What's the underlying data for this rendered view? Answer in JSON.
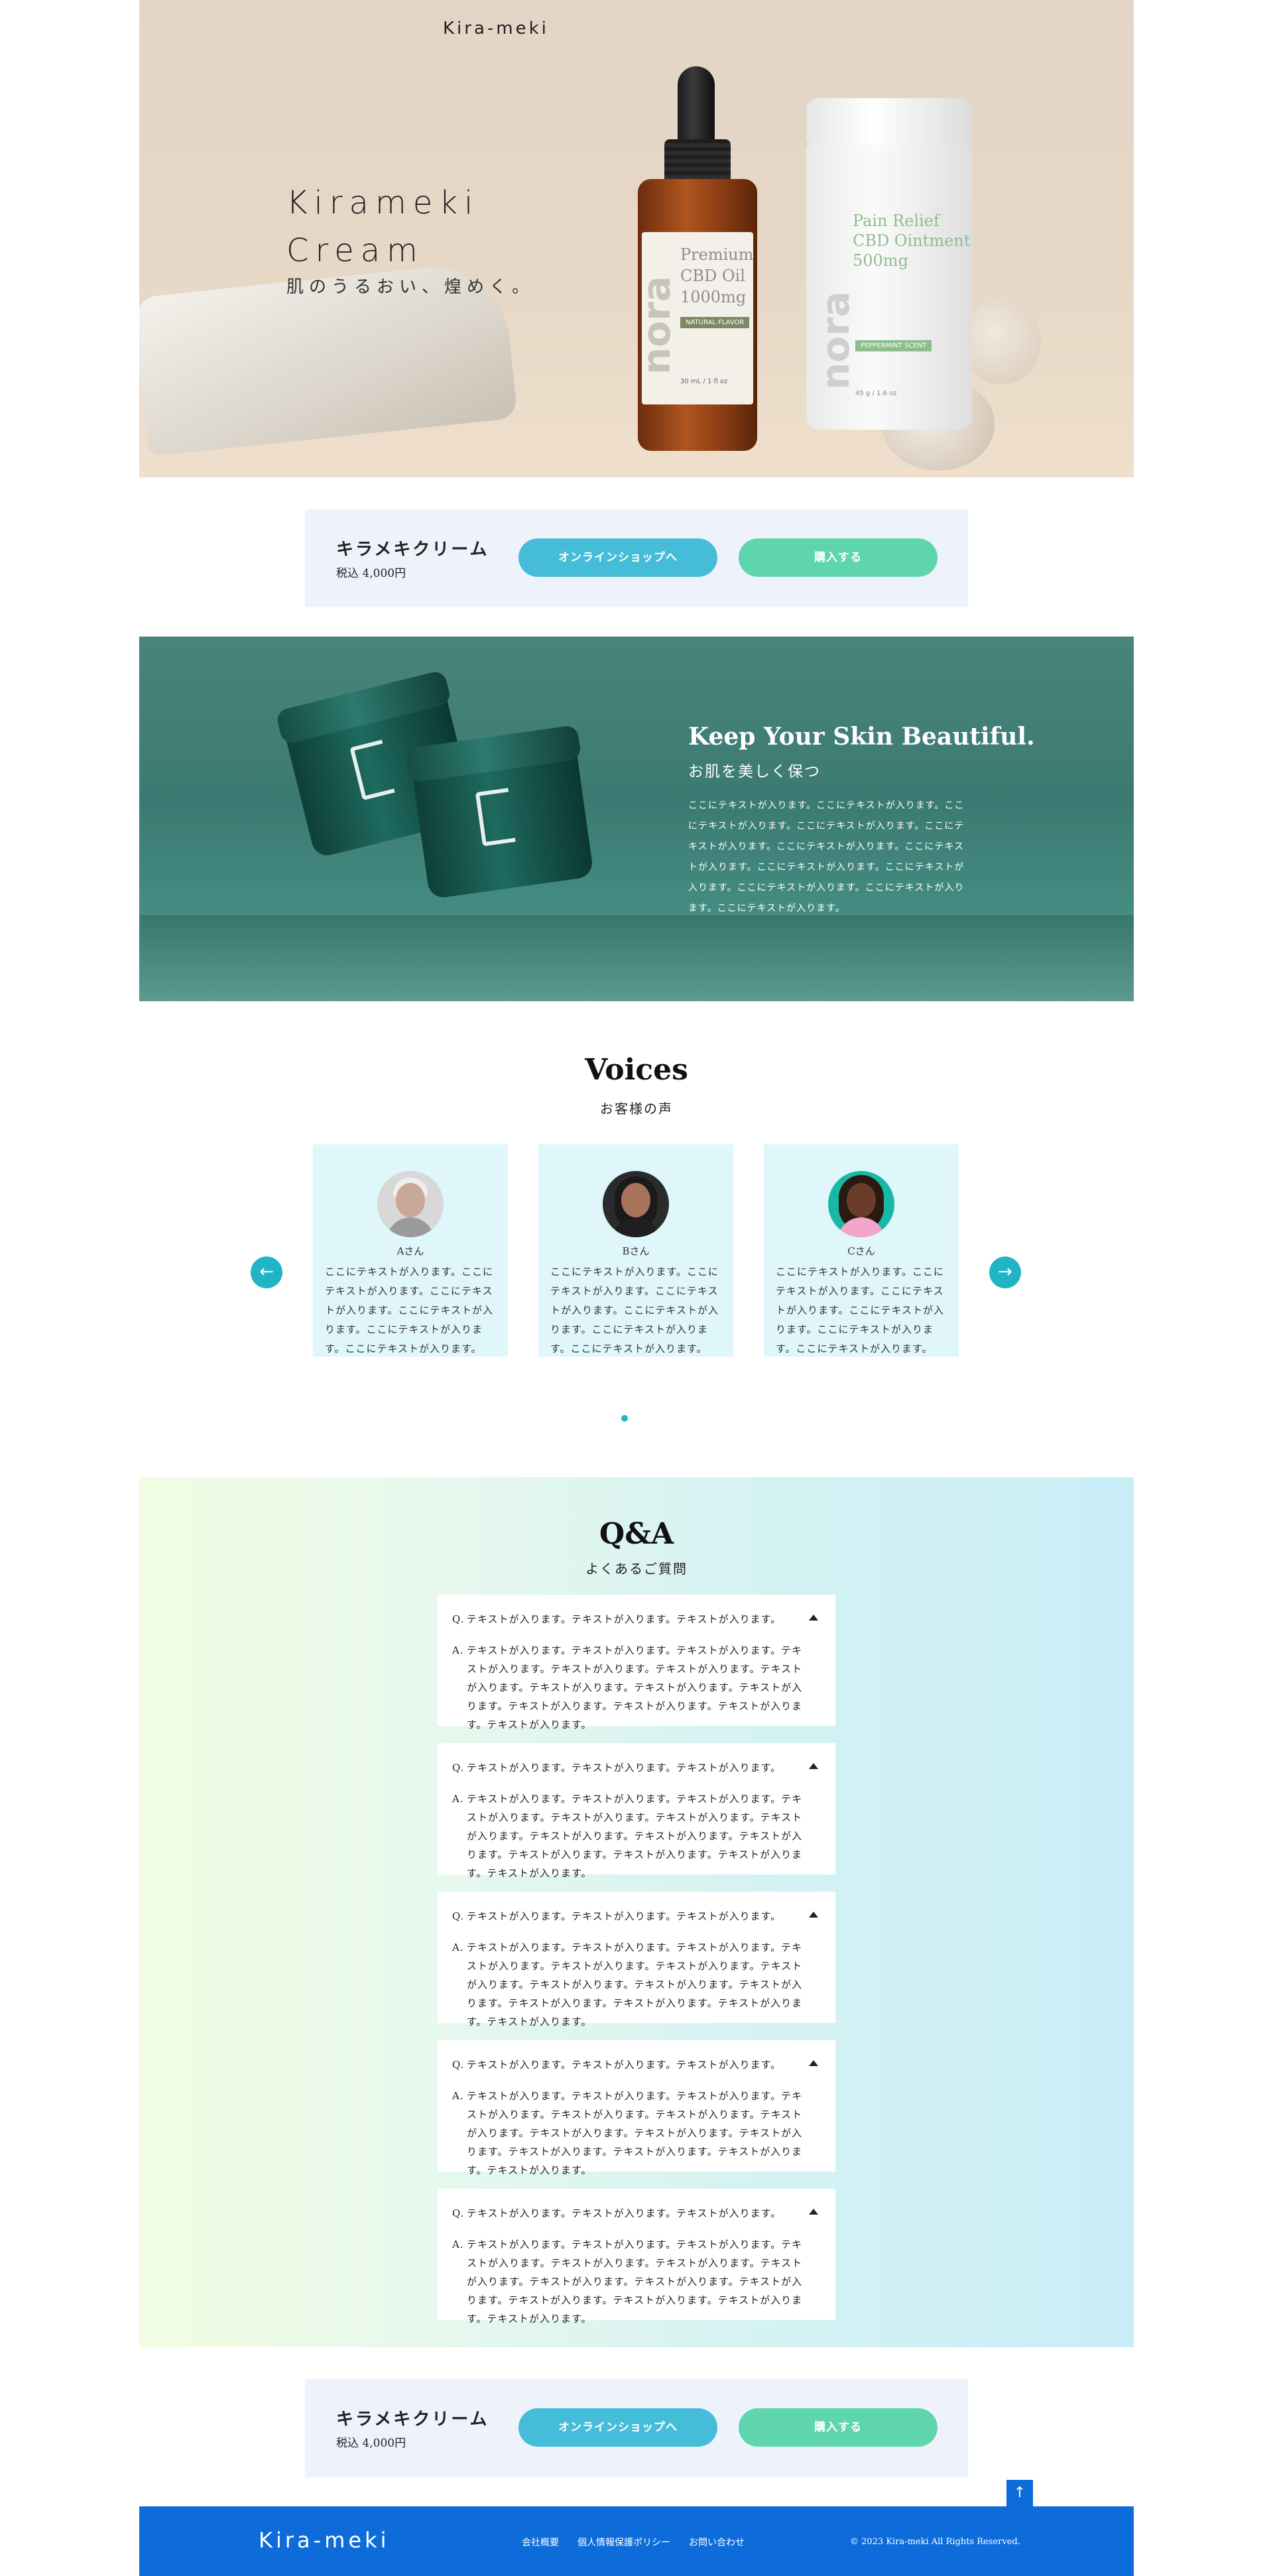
{
  "header": {
    "brand": "Kira-meki"
  },
  "hero": {
    "title_line1": "Kirameki",
    "title_line2": "Cream",
    "subtitle": "肌のうるおい、煌めく。",
    "bottle": {
      "brand": "nora",
      "line1": "Premium",
      "line2": "CBD Oil",
      "line3": "1000mg",
      "badge": "NATURAL FLAVOR",
      "size": "30 mL / 1 fl oz"
    },
    "jar": {
      "brand": "nora",
      "line1": "Pain Relief",
      "line2": "CBD Ointment",
      "line3": "500mg",
      "badge": "PEPPERMINT SCENT",
      "size": "45 g / 1.6 oz"
    }
  },
  "buybar": {
    "product_name": "キラメキクリーム",
    "price": "税込 4,000円",
    "shop_label": "オンラインショップへ",
    "buy_label": "購入する"
  },
  "feature": {
    "title": "Keep Your Skin Beautiful.",
    "subtitle": "お肌を美しく保つ",
    "body": "ここにテキストが入ります。ここにテキストが入ります。ここにテキストが入ります。ここにテキストが入ります。ここにテキストが入ります。ここにテキストが入ります。ここにテキストが入ります。ここにテキストが入ります。ここにテキストが入ります。ここにテキストが入ります。ここにテキストが入ります。ここにテキストが入ります。"
  },
  "voices": {
    "title": "Voices",
    "subtitle": "お客様の声",
    "items": [
      {
        "name": "Aさん",
        "text": "ここにテキストが入ります。ここにテキストが入ります。ここにテキストが入ります。ここにテキストが入ります。ここにテキストが入ります。ここにテキストが入ります。"
      },
      {
        "name": "Bさん",
        "text": "ここにテキストが入ります。ここにテキストが入ります。ここにテキストが入ります。ここにテキストが入ります。ここにテキストが入ります。ここにテキストが入ります。"
      },
      {
        "name": "Cさん",
        "text": "ここにテキストが入ります。ここにテキストが入ります。ここにテキストが入ります。ここにテキストが入ります。ここにテキストが入ります。ここにテキストが入ります。"
      }
    ],
    "prev_icon": "arrow-left-icon",
    "next_icon": "arrow-right-icon"
  },
  "qa": {
    "title": "Q&A",
    "subtitle": "よくあるご質問",
    "q_mark": "Q.",
    "a_mark": "A.",
    "items": [
      {
        "q": "テキストが入ります。テキストが入ります。テキストが入ります。",
        "a": "テキストが入ります。テキストが入ります。テキストが入ります。テキストが入ります。テキストが入ります。テキストが入ります。テキストが入ります。テキストが入ります。テキストが入ります。テキストが入ります。テキストが入ります。テキストが入ります。テキストが入ります。テキストが入ります。"
      },
      {
        "q": "テキストが入ります。テキストが入ります。テキストが入ります。",
        "a": "テキストが入ります。テキストが入ります。テキストが入ります。テキストが入ります。テキストが入ります。テキストが入ります。テキストが入ります。テキストが入ります。テキストが入ります。テキストが入ります。テキストが入ります。テキストが入ります。テキストが入ります。テキストが入ります。"
      },
      {
        "q": "テキストが入ります。テキストが入ります。テキストが入ります。",
        "a": "テキストが入ります。テキストが入ります。テキストが入ります。テキストが入ります。テキストが入ります。テキストが入ります。テキストが入ります。テキストが入ります。テキストが入ります。テキストが入ります。テキストが入ります。テキストが入ります。テキストが入ります。テキストが入ります。"
      },
      {
        "q": "テキストが入ります。テキストが入ります。テキストが入ります。",
        "a": "テキストが入ります。テキストが入ります。テキストが入ります。テキストが入ります。テキストが入ります。テキストが入ります。テキストが入ります。テキストが入ります。テキストが入ります。テキストが入ります。テキストが入ります。テキストが入ります。テキストが入ります。テキストが入ります。"
      },
      {
        "q": "テキストが入ります。テキストが入ります。テキストが入ります。",
        "a": "テキストが入ります。テキストが入ります。テキストが入ります。テキストが入ります。テキストが入ります。テキストが入ります。テキストが入ります。テキストが入ります。テキストが入ります。テキストが入ります。テキストが入ります。テキストが入ります。テキストが入ります。テキストが入ります。"
      }
    ]
  },
  "page_top_icon": "arrow-up-icon",
  "footer": {
    "brand": "Kira-meki",
    "nav": [
      "会社概要",
      "個人情報保護ポリシー",
      "お問い合わせ"
    ],
    "copyright": "© 2023 Kira-meki All Rights Reserved."
  },
  "colors": {
    "accent_blue": "#46bdd8",
    "accent_green": "#5fd5ae",
    "footer_blue": "#0d6cd9",
    "teal": "#3b7a72"
  }
}
